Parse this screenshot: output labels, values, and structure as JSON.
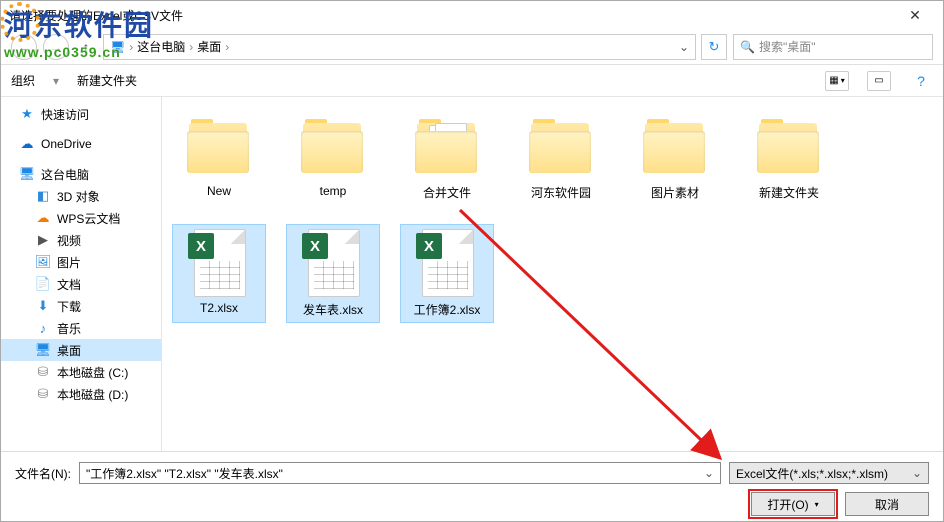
{
  "title": "请选择要处理的Excel或CSV文件",
  "logo": {
    "cn": "河东软件园",
    "url": "www.pc0359.cn"
  },
  "breadcrumb": {
    "pc": "这台电脑",
    "loc": "桌面"
  },
  "search_placeholder": "搜索\"桌面\"",
  "toolbar": {
    "organize": "组织",
    "newfolder": "新建文件夹"
  },
  "sidebar": {
    "quick": "快速访问",
    "onedrive": "OneDrive",
    "thispc": "这台电脑",
    "obj3d": "3D 对象",
    "wps": "WPS云文档",
    "videos": "视频",
    "pictures": "图片",
    "documents": "文档",
    "downloads": "下载",
    "music": "音乐",
    "desktop": "桌面",
    "driveC": "本地磁盘 (C:)",
    "driveD": "本地磁盘 (D:)"
  },
  "files": [
    {
      "label": "New",
      "type": "folder"
    },
    {
      "label": "temp",
      "type": "folder"
    },
    {
      "label": "合并文件",
      "type": "folder-docs"
    },
    {
      "label": "河东软件园",
      "type": "folder-thumb1"
    },
    {
      "label": "图片素材",
      "type": "folder-thumb2"
    },
    {
      "label": "新建文件夹",
      "type": "folder"
    },
    {
      "label": "T2.xlsx",
      "type": "excel"
    },
    {
      "label": "发车表.xlsx",
      "type": "excel"
    },
    {
      "label": "工作簿2.xlsx",
      "type": "excel"
    }
  ],
  "filename_label": "文件名(N):",
  "filename_value": "\"工作簿2.xlsx\" \"T2.xlsx\" \"发车表.xlsx\"",
  "filter": "Excel文件(*.xls;*.xlsx;*.xlsm)",
  "open": "打开(O)",
  "cancel": "取消"
}
